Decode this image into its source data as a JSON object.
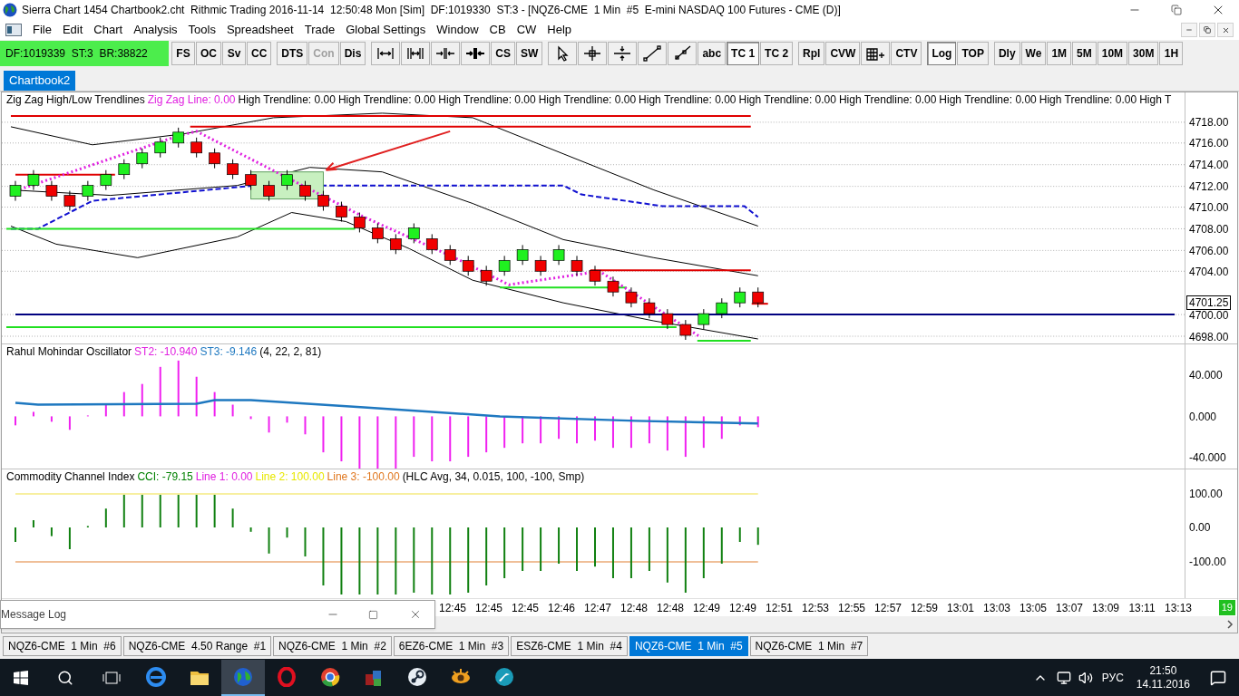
{
  "window": {
    "title": "Sierra Chart 1454 Chartbook2.cht  Rithmic Trading 2016-11-14  12:50:48 Mon [Sim]  DF:1019330  ST:3 - [NQZ6-CME  1 Min  #5  E-mini NASDAQ 100 Futures - CME (D)]"
  },
  "menu": [
    "File",
    "Edit",
    "Chart",
    "Analysis",
    "Tools",
    "Spreadsheet",
    "Trade",
    "Global Settings",
    "Window",
    "CB",
    "CW",
    "Help"
  ],
  "status_box": "DF:1019339  ST:3  BR:38822",
  "toolbar": [
    {
      "kind": "text",
      "label": "FS",
      "gap_before": false,
      "disabled": false,
      "selected": false
    },
    {
      "kind": "text",
      "label": "OC",
      "gap_before": false,
      "disabled": false,
      "selected": false
    },
    {
      "kind": "text",
      "label": "Sv",
      "gap_before": false,
      "disabled": false,
      "selected": false
    },
    {
      "kind": "text",
      "label": "CC",
      "gap_before": false,
      "disabled": false,
      "selected": false
    },
    {
      "kind": "text",
      "label": "DTS",
      "gap_before": true,
      "disabled": false,
      "selected": false
    },
    {
      "kind": "text",
      "label": "Con",
      "gap_before": false,
      "disabled": true,
      "selected": false
    },
    {
      "kind": "text",
      "label": "Dis",
      "gap_before": false,
      "disabled": false,
      "selected": false
    },
    {
      "kind": "icon",
      "gap_before": true,
      "disabled": false,
      "selected": false
    },
    {
      "kind": "icon",
      "gap_before": false,
      "disabled": false,
      "selected": false
    },
    {
      "kind": "icon",
      "gap_before": false,
      "disabled": false,
      "selected": false
    },
    {
      "kind": "icon",
      "gap_before": false,
      "disabled": false,
      "selected": false
    },
    {
      "kind": "text",
      "label": "CS",
      "gap_before": false,
      "disabled": false,
      "selected": false
    },
    {
      "kind": "text",
      "label": "SW",
      "gap_before": false,
      "disabled": false,
      "selected": false
    },
    {
      "kind": "icon",
      "gap_before": true,
      "disabled": false,
      "selected": false
    },
    {
      "kind": "icon",
      "gap_before": false,
      "disabled": false,
      "selected": false
    },
    {
      "kind": "icon",
      "gap_before": false,
      "disabled": false,
      "selected": false
    },
    {
      "kind": "icon",
      "gap_before": false,
      "disabled": false,
      "selected": false
    },
    {
      "kind": "icon",
      "gap_before": false,
      "disabled": false,
      "selected": false
    },
    {
      "kind": "text",
      "label": "abc",
      "gap_before": false,
      "disabled": false,
      "selected": false
    },
    {
      "kind": "text",
      "label": "TC 1",
      "gap_before": false,
      "disabled": false,
      "selected": true
    },
    {
      "kind": "text",
      "label": "TC 2",
      "gap_before": false,
      "disabled": false,
      "selected": false
    },
    {
      "kind": "text",
      "label": "Rpl",
      "gap_before": true,
      "disabled": false,
      "selected": false
    },
    {
      "kind": "text",
      "label": "CVW",
      "gap_before": false,
      "disabled": false,
      "selected": false
    },
    {
      "kind": "icon",
      "gap_before": false,
      "disabled": false,
      "selected": false
    },
    {
      "kind": "text",
      "label": "CTV",
      "gap_before": false,
      "disabled": false,
      "selected": false
    },
    {
      "kind": "text",
      "label": "Log",
      "gap_before": true,
      "disabled": false,
      "selected": true
    },
    {
      "kind": "text",
      "label": "TOP",
      "gap_before": false,
      "disabled": false,
      "selected": false
    },
    {
      "kind": "text",
      "label": "Dly",
      "gap_before": true,
      "disabled": false,
      "selected": false
    },
    {
      "kind": "text",
      "label": "We",
      "gap_before": false,
      "disabled": false,
      "selected": false
    },
    {
      "kind": "text",
      "label": "1M",
      "gap_before": false,
      "disabled": false,
      "selected": false
    },
    {
      "kind": "text",
      "label": "5M",
      "gap_before": false,
      "disabled": false,
      "selected": false
    },
    {
      "kind": "text",
      "label": "10M",
      "gap_before": false,
      "disabled": false,
      "selected": false
    },
    {
      "kind": "text",
      "label": "30M",
      "gap_before": false,
      "disabled": false,
      "selected": false
    },
    {
      "kind": "text",
      "label": "1H",
      "gap_before": false,
      "disabled": false,
      "selected": false
    }
  ],
  "chartbook_tab": {
    "label": "Chartbook2",
    "selected": true
  },
  "price_panel": {
    "title": "Zig Zag High/Low Trendlines",
    "values": [
      {
        "text": "Zig Zag Line: 0.00",
        "color": "#e020e0"
      },
      {
        "text": "High Trendline: 0.00",
        "color": "#000000"
      },
      {
        "text": "High Trendline: 0.00",
        "color": "#000000"
      },
      {
        "text": "High Trendline: 0.00",
        "color": "#000000"
      },
      {
        "text": "High Trendline: 0.00",
        "color": "#000000"
      },
      {
        "text": "High Trendline: 0.00",
        "color": "#000000"
      },
      {
        "text": "High Trendline: 0.00",
        "color": "#000000"
      },
      {
        "text": "High Trendline: 0.00",
        "color": "#000000"
      },
      {
        "text": "High Trendline: 0.00",
        "color": "#000000"
      },
      {
        "text": "High Trendline: 0.00",
        "color": "#000000"
      },
      {
        "text": "High T",
        "color": "#000000"
      }
    ],
    "axis": [
      "4718.00",
      "4716.00",
      "4714.00",
      "4712.00",
      "4710.00",
      "4708.00",
      "4706.00",
      "4704.00",
      "4700.00",
      "4698.00"
    ],
    "last_price": "4701.25"
  },
  "oscillator_panel": {
    "title": "Rahul Mohindar Oscillator",
    "values": [
      {
        "text": "ST2: -10.940",
        "color": "#e020e0"
      },
      {
        "text": "ST3: -9.146",
        "color": "#1e78c0"
      },
      {
        "text": "(4, 22, 2, 81)",
        "color": "#000000"
      }
    ],
    "axis": [
      "40.000",
      "0.000",
      "-40.000"
    ]
  },
  "cci_panel": {
    "title": "Commodity Channel Index",
    "values": [
      {
        "text": "CCI: -79.15",
        "color": "#008000"
      },
      {
        "text": "Line 1: 0.00",
        "color": "#e020e0"
      },
      {
        "text": "Line 2: 100.00",
        "color": "#e8e800"
      },
      {
        "text": "Line 3: -100.00",
        "color": "#e07820"
      },
      {
        "text": "(HLC Avg, 34, 0.015, 100, -100, Smp)",
        "color": "#000000"
      }
    ],
    "axis": [
      "100.00",
      "0.00",
      "-100.00"
    ]
  },
  "time_axis": {
    "labels": [
      "12:45",
      "12:45",
      "12:45",
      "12:46",
      "12:47",
      "12:48",
      "12:48",
      "12:49",
      "12:49",
      "12:51",
      "12:53",
      "12:55",
      "12:57",
      "12:59",
      "13:01",
      "13:03",
      "13:05",
      "13:07",
      "13:09",
      "13:11",
      "13:13"
    ],
    "badge": "19"
  },
  "message_log": {
    "title": "Message Log"
  },
  "chart_tabs": [
    {
      "label": "NQZ6-CME  1 Min  #6",
      "selected": false
    },
    {
      "label": "NQZ6-CME  4.50 Range  #1",
      "selected": false
    },
    {
      "label": "NQZ6-CME  1 Min  #2",
      "selected": false
    },
    {
      "label": "6EZ6-CME  1 Min  #3",
      "selected": false
    },
    {
      "label": "ESZ6-CME  1 Min  #4",
      "selected": false
    },
    {
      "label": "NQZ6-CME  1 Min  #5",
      "selected": true
    },
    {
      "label": "NQZ6-CME  1 Min  #7",
      "selected": false
    }
  ],
  "taskbar": {
    "apps": [
      {
        "selected": false
      },
      {
        "selected": false
      },
      {
        "selected": true
      },
      {
        "selected": false
      },
      {
        "selected": false
      },
      {
        "selected": false
      },
      {
        "selected": false
      },
      {
        "selected": false
      },
      {
        "selected": false
      }
    ],
    "language": "РУС",
    "time": "21:50",
    "date": "14.11.2016"
  }
}
